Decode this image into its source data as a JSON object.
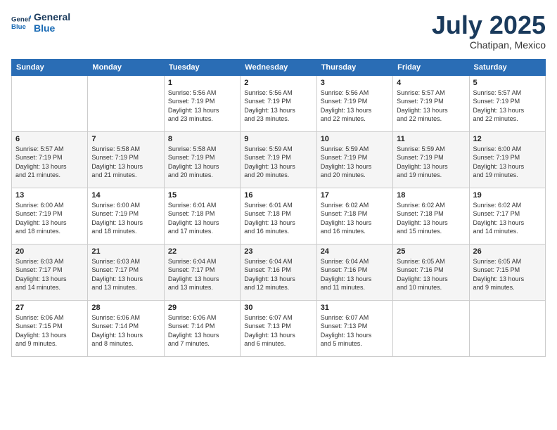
{
  "header": {
    "logo": {
      "line1": "General",
      "line2": "Blue"
    },
    "month": "July 2025",
    "location": "Chatipan, Mexico"
  },
  "days_of_week": [
    "Sunday",
    "Monday",
    "Tuesday",
    "Wednesday",
    "Thursday",
    "Friday",
    "Saturday"
  ],
  "weeks": [
    [
      {
        "day": "",
        "info": ""
      },
      {
        "day": "",
        "info": ""
      },
      {
        "day": "1",
        "info": "Sunrise: 5:56 AM\nSunset: 7:19 PM\nDaylight: 13 hours\nand 23 minutes."
      },
      {
        "day": "2",
        "info": "Sunrise: 5:56 AM\nSunset: 7:19 PM\nDaylight: 13 hours\nand 23 minutes."
      },
      {
        "day": "3",
        "info": "Sunrise: 5:56 AM\nSunset: 7:19 PM\nDaylight: 13 hours\nand 22 minutes."
      },
      {
        "day": "4",
        "info": "Sunrise: 5:57 AM\nSunset: 7:19 PM\nDaylight: 13 hours\nand 22 minutes."
      },
      {
        "day": "5",
        "info": "Sunrise: 5:57 AM\nSunset: 7:19 PM\nDaylight: 13 hours\nand 22 minutes."
      }
    ],
    [
      {
        "day": "6",
        "info": "Sunrise: 5:57 AM\nSunset: 7:19 PM\nDaylight: 13 hours\nand 21 minutes."
      },
      {
        "day": "7",
        "info": "Sunrise: 5:58 AM\nSunset: 7:19 PM\nDaylight: 13 hours\nand 21 minutes."
      },
      {
        "day": "8",
        "info": "Sunrise: 5:58 AM\nSunset: 7:19 PM\nDaylight: 13 hours\nand 20 minutes."
      },
      {
        "day": "9",
        "info": "Sunrise: 5:59 AM\nSunset: 7:19 PM\nDaylight: 13 hours\nand 20 minutes."
      },
      {
        "day": "10",
        "info": "Sunrise: 5:59 AM\nSunset: 7:19 PM\nDaylight: 13 hours\nand 20 minutes."
      },
      {
        "day": "11",
        "info": "Sunrise: 5:59 AM\nSunset: 7:19 PM\nDaylight: 13 hours\nand 19 minutes."
      },
      {
        "day": "12",
        "info": "Sunrise: 6:00 AM\nSunset: 7:19 PM\nDaylight: 13 hours\nand 19 minutes."
      }
    ],
    [
      {
        "day": "13",
        "info": "Sunrise: 6:00 AM\nSunset: 7:19 PM\nDaylight: 13 hours\nand 18 minutes."
      },
      {
        "day": "14",
        "info": "Sunrise: 6:00 AM\nSunset: 7:19 PM\nDaylight: 13 hours\nand 18 minutes."
      },
      {
        "day": "15",
        "info": "Sunrise: 6:01 AM\nSunset: 7:18 PM\nDaylight: 13 hours\nand 17 minutes."
      },
      {
        "day": "16",
        "info": "Sunrise: 6:01 AM\nSunset: 7:18 PM\nDaylight: 13 hours\nand 16 minutes."
      },
      {
        "day": "17",
        "info": "Sunrise: 6:02 AM\nSunset: 7:18 PM\nDaylight: 13 hours\nand 16 minutes."
      },
      {
        "day": "18",
        "info": "Sunrise: 6:02 AM\nSunset: 7:18 PM\nDaylight: 13 hours\nand 15 minutes."
      },
      {
        "day": "19",
        "info": "Sunrise: 6:02 AM\nSunset: 7:17 PM\nDaylight: 13 hours\nand 14 minutes."
      }
    ],
    [
      {
        "day": "20",
        "info": "Sunrise: 6:03 AM\nSunset: 7:17 PM\nDaylight: 13 hours\nand 14 minutes."
      },
      {
        "day": "21",
        "info": "Sunrise: 6:03 AM\nSunset: 7:17 PM\nDaylight: 13 hours\nand 13 minutes."
      },
      {
        "day": "22",
        "info": "Sunrise: 6:04 AM\nSunset: 7:17 PM\nDaylight: 13 hours\nand 13 minutes."
      },
      {
        "day": "23",
        "info": "Sunrise: 6:04 AM\nSunset: 7:16 PM\nDaylight: 13 hours\nand 12 minutes."
      },
      {
        "day": "24",
        "info": "Sunrise: 6:04 AM\nSunset: 7:16 PM\nDaylight: 13 hours\nand 11 minutes."
      },
      {
        "day": "25",
        "info": "Sunrise: 6:05 AM\nSunset: 7:16 PM\nDaylight: 13 hours\nand 10 minutes."
      },
      {
        "day": "26",
        "info": "Sunrise: 6:05 AM\nSunset: 7:15 PM\nDaylight: 13 hours\nand 9 minutes."
      }
    ],
    [
      {
        "day": "27",
        "info": "Sunrise: 6:06 AM\nSunset: 7:15 PM\nDaylight: 13 hours\nand 9 minutes."
      },
      {
        "day": "28",
        "info": "Sunrise: 6:06 AM\nSunset: 7:14 PM\nDaylight: 13 hours\nand 8 minutes."
      },
      {
        "day": "29",
        "info": "Sunrise: 6:06 AM\nSunset: 7:14 PM\nDaylight: 13 hours\nand 7 minutes."
      },
      {
        "day": "30",
        "info": "Sunrise: 6:07 AM\nSunset: 7:13 PM\nDaylight: 13 hours\nand 6 minutes."
      },
      {
        "day": "31",
        "info": "Sunrise: 6:07 AM\nSunset: 7:13 PM\nDaylight: 13 hours\nand 5 minutes."
      },
      {
        "day": "",
        "info": ""
      },
      {
        "day": "",
        "info": ""
      }
    ]
  ]
}
